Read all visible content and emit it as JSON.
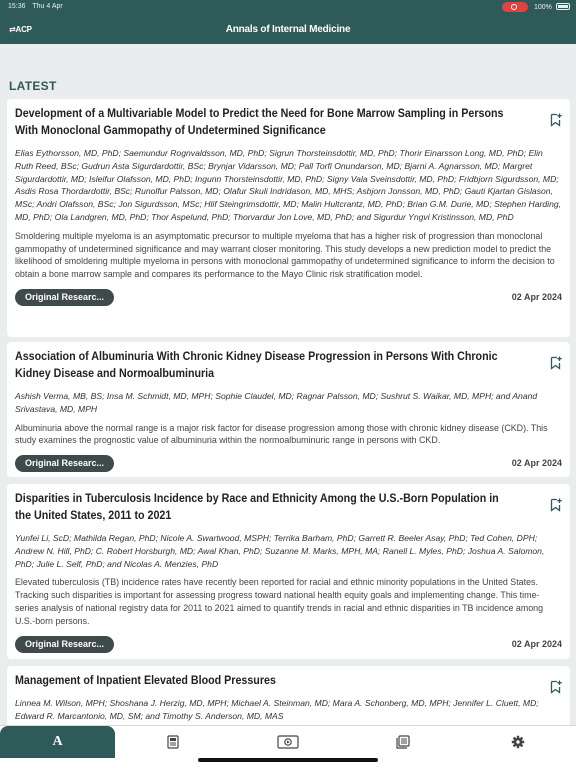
{
  "status": {
    "time": "15:36",
    "date": "Thu 4 Apr",
    "battery": "100%"
  },
  "nav": {
    "logo": "ACP",
    "title": "Annals of Internal Medicine"
  },
  "section_label": "LATEST",
  "articles": [
    {
      "title": "Development of a Multivariable Model to Predict the Need for Bone Marrow Sampling in Persons With Monoclonal Gammopathy of Undetermined Significance",
      "authors": "Elias Eythorsson, MD, PhD; Saemundur Rognvaldsson, MD, PhD; Sigrun Thorsteinsdottir, MD, PhD; Thorir Einarsson Long, MD, PhD; Elin Ruth Reed, BSc; Gudrun Asta Sigurdardottir, BSc; Brynjar Vidarsson, MD; Pall Torfi Onundarson, MD; Bjarni A. Agnarsson, MD; Margret Sigurdardottir, MD; Isleifur Olafsson, MD, PhD; Ingunn Thorsteinsdottir, MD, PhD; Signy Vala Sveinsdottir, MD, PhD; Fridbjorn Sigurdsson, MD; Asdis Rosa Thordardottir, BSc; Runolfur Palsson, MD; Olafur Skuli Indridason, MD, MHS; Asbjorn Jonsson, MD, PhD; Gauti Kjartan Gislason, MSc; Andri Olafsson, BSc; Jon Sigurdsson, MSc; Hlif Steingrimsdottir, MD; Malin Hultcrantz, MD, PhD; Brian G.M. Durie, MD; Stephen Harding, MD, PhD; Ola Landgren, MD, PhD; Thor Aspelund, PhD; Thorvardur Jon Love, MD, PhD; and Sigurdur Yngvi Kristinsson, MD, PhD",
      "abstract": "Smoldering multiple myeloma is an asymptomatic precursor to multiple myeloma that has a higher risk of progression than monoclonal gammopathy of undetermined significance and may warrant closer monitoring. This study develops a new prediction model to predict the likelihood of smoldering multiple myeloma in persons with monoclonal gammopathy of undetermined significance to inform the decision to obtain a bone marrow sample and compares its performance to the Mayo Clinic risk stratification model.",
      "type": "Original Researc...",
      "date": "02 Apr 2024"
    },
    {
      "title": "Association of Albuminuria With Chronic Kidney Disease Progression in Persons With Chronic Kidney Disease and Normoalbuminuria",
      "authors": "Ashish Verma, MB, BS; Insa M. Schmidt, MD, MPH; Sophie Claudel, MD; Ragnar Palsson, MD; Sushrut S. Waikar, MD, MPH; and Anand Srivastava, MD, MPH",
      "abstract": "Albuminuria above the normal range is a major risk factor for disease progression among those with chronic kidney disease (CKD). This study examines the prognostic value of albuminuria within the normoalbuminuric range in persons with CKD.",
      "type": "Original Researc...",
      "date": "02 Apr 2024"
    },
    {
      "title": "Disparities in Tuberculosis Incidence by Race and Ethnicity Among the U.S.-Born Population in the United States, 2011 to 2021",
      "authors": "Yunfei Li, ScD; Mathilda Regan, PhD; Nicole A. Swartwood, MSPH; Terrika Barham, PhD; Garrett R. Beeler Asay, PhD; Ted Cohen, DPH; Andrew N. Hill, PhD; C. Robert Horsburgh, MD; Awal Khan, PhD; Suzanne M. Marks, MPH, MA; Ranell L. Myles, PhD; Joshua A. Salomon, PhD; Julie L. Self, PhD; and Nicolas A. Menzies, PhD",
      "abstract": "Elevated tuberculosis (TB) incidence rates have recently been reported for racial and ethnic minority populations in the United States. Tracking such disparities is important for assessing progress toward national health equity goals and implementing change. This time-series analysis of national registry data for 2011 to 2021 aimed to quantify trends in racial and ethnic disparities in TB incidence among U.S.-born persons.",
      "type": "Original Researc...",
      "date": "02 Apr 2024"
    },
    {
      "title": "Management of Inpatient Elevated Blood Pressures",
      "authors": "Linnea M. Wilson, MPH; Shoshana J. Herzig, MD, MPH; Michael A. Steinman, MD; Mara A. Schonberg, MD, MPH; Jennifer L. Cluett, MD; Edward R. Marcantonio, MD, SM; and Timothy S. Anderson, MD, MAS"
    }
  ],
  "tabs": [
    {
      "icon": "latest-icon",
      "label": "A",
      "active": true
    },
    {
      "icon": "issue-icon"
    },
    {
      "icon": "video-icon"
    },
    {
      "icon": "collection-icon"
    },
    {
      "icon": "settings-gear-icon"
    }
  ]
}
